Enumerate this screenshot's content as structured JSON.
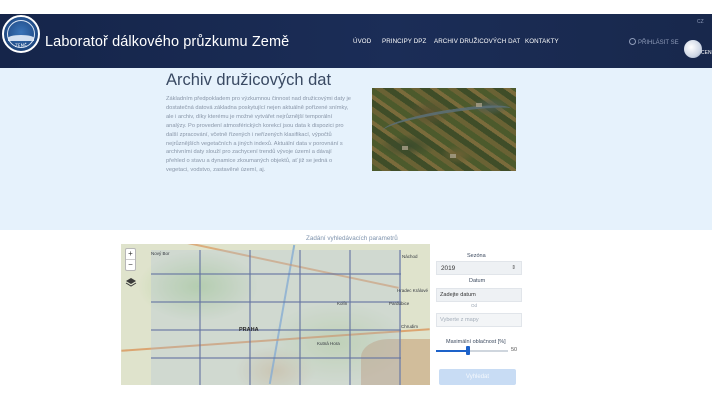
{
  "header": {
    "logo_text": "ZEMĚ",
    "site_title": "Laboratoř dálkového průzkumu Země",
    "nav": [
      {
        "label": "ÚVOD"
      },
      {
        "label": "PRINCIPY DPZ"
      },
      {
        "label": "ARCHIV DRUŽICOVÝCH DAT"
      },
      {
        "label": "KONTAKTY"
      }
    ],
    "login_label": "PŘIHLÁSIT SE",
    "lang_label": "CZ",
    "partner_label": "CEN"
  },
  "hero": {
    "title": "Archiv družicových dat",
    "text": "Základním předpokladem pro výzkumnou činnost nad družicovými daty je dostatečná datová základna poskytující nejen aktuálně pořízené snímky, ale i archiv, díky kterému je možné vytvářet nejrůznější temporální analýzy. Po provedení atmosférických korekcí jsou data k dispozici pro další zpracování, včetně řízených i neřízených klasifikací, výpočtů nejrůznějších vegetačních a jiných indexů. Aktuální data v porovnání s archivními daty slouží pro zachycení trendů vývoje území a dávají přehled o stavu a dynamice zkoumaných objektů, ať již se jedná o vegetaci, vodstvo, zastavěné území, aj."
  },
  "search": {
    "section_title": "Zadání vyhledávacích parametrů",
    "map_labels": {
      "city_west": "Nový Bor",
      "city_northeast": "Náchod",
      "city_east1": "Hradec Králové",
      "city_east2": "Pardubice",
      "city_capital": "PRAHA",
      "city_mid": "Kolín",
      "city_south": "Kutná Hora",
      "city_east3": "Chrudim"
    },
    "zoom_in": "+",
    "zoom_out": "−",
    "season_label": "Sezóna",
    "season_value": "2019",
    "date_label": "Datum",
    "date_placeholder": "Zadejte datum",
    "range_hint": "Od",
    "map_pick_placeholder": "Vyberte z mapy",
    "cloud_label": "Maximální oblačnost [%]",
    "cloud_value": "50",
    "cloud_fraction": 0.45,
    "search_button": "Vyhledat"
  }
}
